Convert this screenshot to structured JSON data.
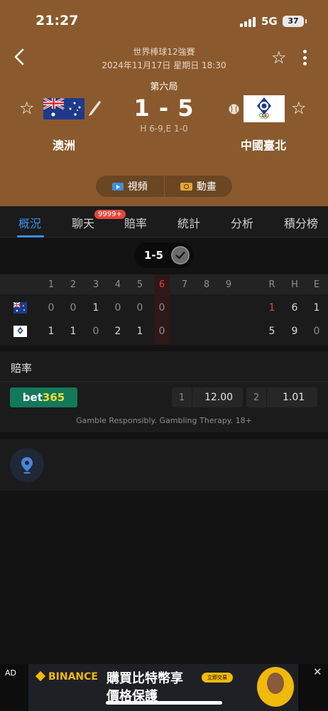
{
  "status_bar": {
    "time": "21:27",
    "network": "5G",
    "battery": "37"
  },
  "header": {
    "league": "世界棒球12強賽",
    "datetime": "2024年11月17日 星期日 18:30",
    "inning": "第六局",
    "score": "1 - 5",
    "subscore": "H 6-9,E 1-0",
    "home_team": "澳洲",
    "away_team": "中國臺北"
  },
  "media": {
    "video_label": "視頻",
    "animation_label": "動畫"
  },
  "tabs": [
    {
      "label": "概況",
      "active": true
    },
    {
      "label": "聊天",
      "badge": "9999+"
    },
    {
      "label": "賠率"
    },
    {
      "label": "統計"
    },
    {
      "label": "分析"
    },
    {
      "label": "積分榜"
    }
  ],
  "score_pill": "1-5",
  "linescore": {
    "innings": [
      "1",
      "2",
      "3",
      "4",
      "5",
      "6",
      "7",
      "8",
      "9"
    ],
    "totals_headers": [
      "R",
      "H",
      "E"
    ],
    "current_inning": "6",
    "rows": [
      {
        "team": "澳洲",
        "innings": [
          "0",
          "0",
          "1",
          "0",
          "0",
          "0",
          "",
          "",
          ""
        ],
        "totals": [
          "1",
          "6",
          "1"
        ]
      },
      {
        "team": "中國臺北",
        "innings": [
          "1",
          "1",
          "0",
          "2",
          "1",
          "0",
          "",
          "",
          ""
        ],
        "totals": [
          "5",
          "9",
          "0"
        ]
      }
    ]
  },
  "odds": {
    "title": "賠率",
    "bookmaker_a": "bet",
    "bookmaker_b": "365",
    "opt1_label": "1",
    "opt1_value": "12.00",
    "opt2_label": "2",
    "opt2_value": "1.01",
    "disclaimer": "Gamble Responsibly. Gambling Therapy. 18+"
  },
  "ad": {
    "tag": "AD",
    "brand": "BINANCE",
    "line1": "購買比特幣享",
    "line2": "價格保護",
    "cta": "立即交易",
    "close": "✕"
  },
  "colors": {
    "accent": "#3b8ee6",
    "hero": "#8a5a2e",
    "highlight_red": "#e0473d"
  }
}
